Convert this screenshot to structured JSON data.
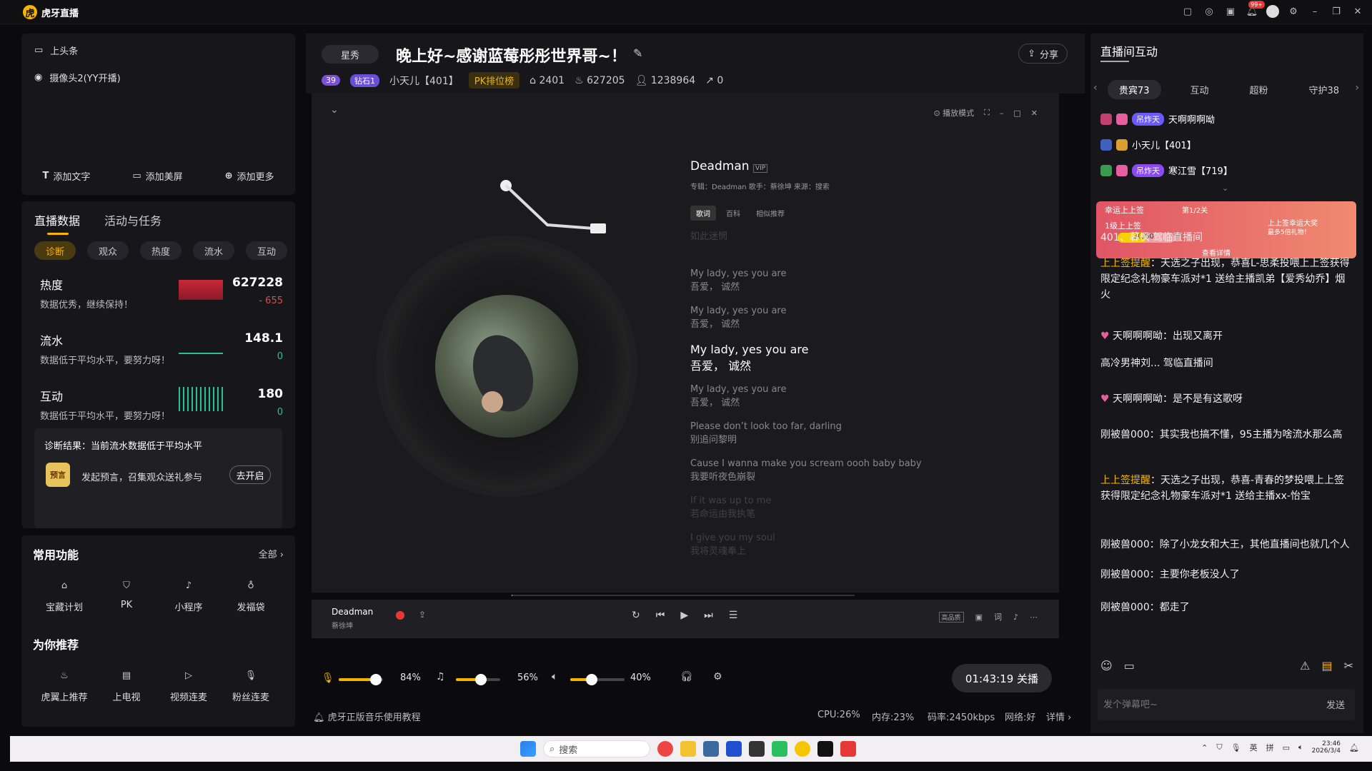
{
  "app": {
    "name": "虎牙直播",
    "notif_badge": "99+"
  },
  "scene": {
    "items": [
      "上头条",
      "摄像头2(YY开播)"
    ],
    "actions": [
      "添加文字",
      "添加美屏",
      "添加更多"
    ]
  },
  "data_panel": {
    "tabs": [
      "直播数据",
      "活动与任务"
    ],
    "pills": [
      "诊断",
      "观众",
      "热度",
      "流水",
      "互动"
    ],
    "metrics": [
      {
        "name": "热度",
        "sub": "数据优秀，继续保持！",
        "value": "627228",
        "change": "- 655"
      },
      {
        "name": "流水",
        "sub": "数据低于平均水平，要努力呀！",
        "value": "148.1",
        "change": "0"
      },
      {
        "name": "互动",
        "sub": "数据低于平均水平，要努力呀！",
        "value": "180",
        "change": "0"
      }
    ],
    "diagnosis": "诊断结果：当前流水数据低于平均水平",
    "preview_icon_label": "预言",
    "preview_text": "发起预言，召集观众送礼参与",
    "go_button": "去开启"
  },
  "functions": {
    "title": "常用功能",
    "all": "全部",
    "items": [
      "宝藏计划",
      "PK",
      "小程序",
      "发福袋"
    ],
    "recommend_title": "为你推荐",
    "recommend": [
      "虎翼上推荐",
      "上电视",
      "视频连麦",
      "粉丝连麦"
    ]
  },
  "stream": {
    "category": "星秀",
    "title": "晚上好~感谢蓝莓彤彤世界哥~！",
    "share": "分享",
    "level": "39",
    "rank": "钻石1",
    "anchor": "小天儿【401】",
    "pk_rank": "PK排位榜",
    "stat1": "2401",
    "stat2": "627205",
    "stat3": "1238964",
    "stat4": "0"
  },
  "player": {
    "mode": "播放模式",
    "song": "Deadman",
    "meta": "专辑：Deadman   歌手：蔡徐坤   来源：搜索",
    "lyric_tabs": [
      "歌词",
      "百科",
      "相似推荐"
    ],
    "lyrics": [
      {
        "en": "",
        "cn": "如此迷惘",
        "state": "fade"
      },
      {
        "en": "My lady, yes you are",
        "cn": "吾爱，  诚然",
        "state": "normal"
      },
      {
        "en": "My lady, yes you are",
        "cn": "吾爱，  诚然",
        "state": "normal"
      },
      {
        "en": "My lady, yes you are",
        "cn": "吾爱，  诚然",
        "state": "cur"
      },
      {
        "en": "My lady, yes you are",
        "cn": "吾爱，  诚然",
        "state": "normal"
      },
      {
        "en": "Please don’t look too far, darling",
        "cn": "别追问黎明",
        "state": "normal"
      },
      {
        "en": "Cause I wanna make you scream oooh baby baby",
        "cn": "我要听夜色崩裂",
        "state": "normal"
      },
      {
        "en": "If it was up to me",
        "cn": "若命运由我执笔",
        "state": "fade"
      },
      {
        "en": "I give you my soul",
        "cn": "我将灵魂奉上",
        "state": "fade"
      }
    ],
    "bottom_song": "Deadman",
    "bottom_artist": "蔡徐坤",
    "quality": "高品质"
  },
  "volume": {
    "mic": "84%",
    "music": "56%",
    "speaker": "40%",
    "mic_level": 0.84,
    "music_level": 0.56,
    "speaker_level": 0.4,
    "live_btn": "01:43:19 关播"
  },
  "status": {
    "tip": "虎牙正版音乐使用教程",
    "cpu": "CPU:26%",
    "mem": "内存:23%",
    "bitrate": "码率:2450kbps",
    "net": "网络:好",
    "detail": "详情"
  },
  "interaction": {
    "title": "直播间互动",
    "tabs": [
      "贵宾73",
      "互动",
      "超粉",
      "守护38"
    ],
    "vips": [
      {
        "badge": "吊炸天",
        "name": "天啊啊啊呦"
      },
      {
        "badge": "",
        "name": "小天儿【401】"
      },
      {
        "badge": "吊炸天",
        "name": "寒江雪【719】"
      }
    ],
    "promo": {
      "title": "幸运上上签",
      "step": "第1/2关",
      "task": "1级上上签",
      "progress": "30/60",
      "progress_value": 0.5,
      "reward": "上上签幸运大奖",
      "reward_sub": "最多5倍礼物！",
      "more": "查看详情"
    },
    "chats": [
      {
        "name": "",
        "text": "401、暮枫  驾临直播间",
        "type": "enter"
      },
      {
        "name": "上上签提醒",
        "text": "：天选之子出现，恭喜L-思柔投喂上上签获得限定纪念礼物豪车派对*1 送给主播凯弟【爱秀幼乔】烟火",
        "type": "yellow"
      },
      {
        "name": "天啊啊啊呦",
        "text": "：出现又离开",
        "type": "user"
      },
      {
        "name": "",
        "text": "高冷男神刘...  驾临直播间",
        "type": "enter"
      },
      {
        "name": "天啊啊啊呦",
        "text": "：是不是有这歌呀",
        "type": "user"
      },
      {
        "name": "刚被兽000",
        "text": "：其实我也搞不懂，95主播为啥流水那么高",
        "type": "plain"
      },
      {
        "name": "上上签提醒",
        "text": "：天选之子出现，恭喜-青春的梦投喂上上签获得限定纪念礼物豪车派对*1 送给主播xx-怡宝",
        "type": "yellow"
      },
      {
        "name": "刚被兽000",
        "text": "：除了小龙女和大王，其他直播间也就几个人",
        "type": "plain"
      },
      {
        "name": "刚被兽000",
        "text": "：主要你老板没人了",
        "type": "plain"
      },
      {
        "name": "刚被兽000",
        "text": "：都走了",
        "type": "plain"
      }
    ],
    "input_placeholder": "发个弹幕吧~",
    "send": "发送"
  },
  "taskbar": {
    "search": "搜索",
    "tray_lang": "英",
    "tray_ime": "拼",
    "time": "23:46",
    "date": "2026/3/4"
  }
}
